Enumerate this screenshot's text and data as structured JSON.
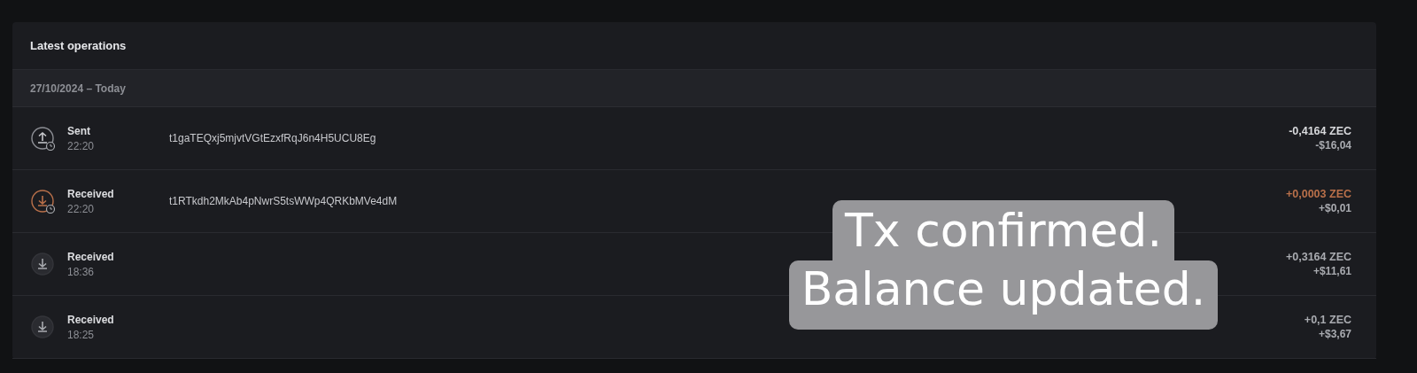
{
  "panel": {
    "title": "Latest operations",
    "date_group": "27/10/2024 – Today",
    "operations": [
      {
        "kind": "sent",
        "label": "Sent",
        "time": "22:20",
        "pending": true,
        "address": "t1gaTEQxj5mjvtVGtEzxfRqJ6n4H5UCU8Eg",
        "amount": "-0,4164 ZEC",
        "fiat": "-$16,04",
        "color": "#d8d9dc"
      },
      {
        "kind": "received",
        "label": "Received",
        "time": "22:20",
        "pending": true,
        "address": "t1RTkdh2MkAb4pNwrS5tsWWp4QRKbMVe4dM",
        "amount": "+0,0003 ZEC",
        "fiat": "+$0,01",
        "color": "#b9704a"
      },
      {
        "kind": "received",
        "label": "Received",
        "time": "18:36",
        "pending": false,
        "amount": "+0,3164 ZEC",
        "fiat": "+$11,61",
        "color": "#a9abb0"
      },
      {
        "kind": "received",
        "label": "Received",
        "time": "18:25",
        "pending": false,
        "amount": "+0,1 ZEC",
        "fiat": "+$3,67",
        "color": "#a9abb0"
      }
    ]
  },
  "caption": {
    "lines": [
      "Tx confirmed.",
      "Balance updated."
    ]
  }
}
